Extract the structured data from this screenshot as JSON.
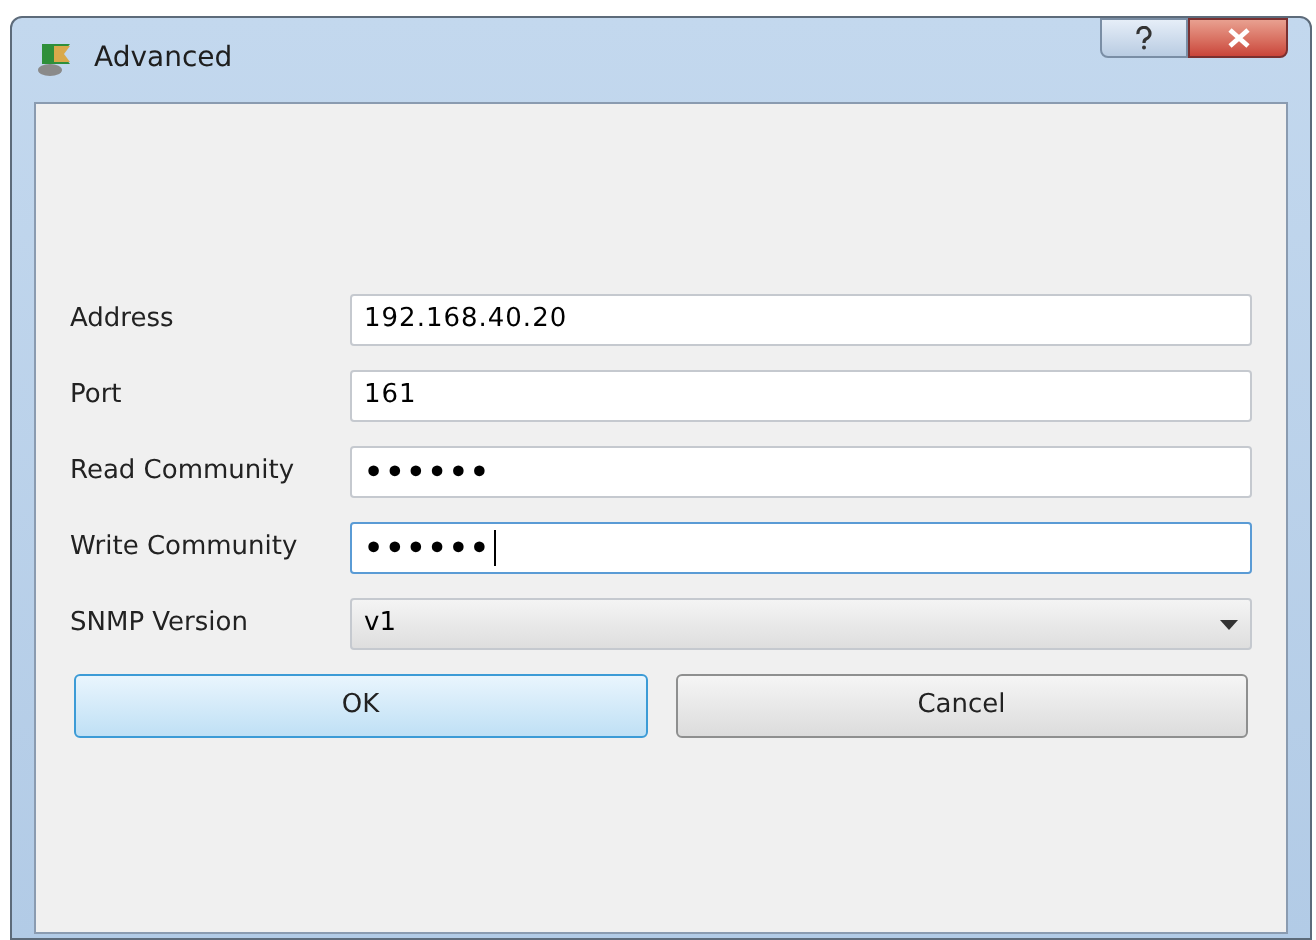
{
  "window": {
    "title": "Advanced"
  },
  "fields": [
    {
      "kind": "text",
      "label": "Address",
      "value": "192.168.40.20",
      "focused": false
    },
    {
      "kind": "text",
      "label": "Port",
      "value": "161",
      "focused": false
    },
    {
      "kind": "password",
      "label": "Read Community",
      "value": "••••••",
      "focused": false
    },
    {
      "kind": "password",
      "label": "Write Community",
      "value": "••••••",
      "focused": true
    },
    {
      "kind": "select",
      "label": "SNMP Version",
      "value": "v1",
      "focused": false
    }
  ],
  "buttons": [
    {
      "label": "OK",
      "default": true
    },
    {
      "label": "Cancel",
      "default": false
    }
  ]
}
